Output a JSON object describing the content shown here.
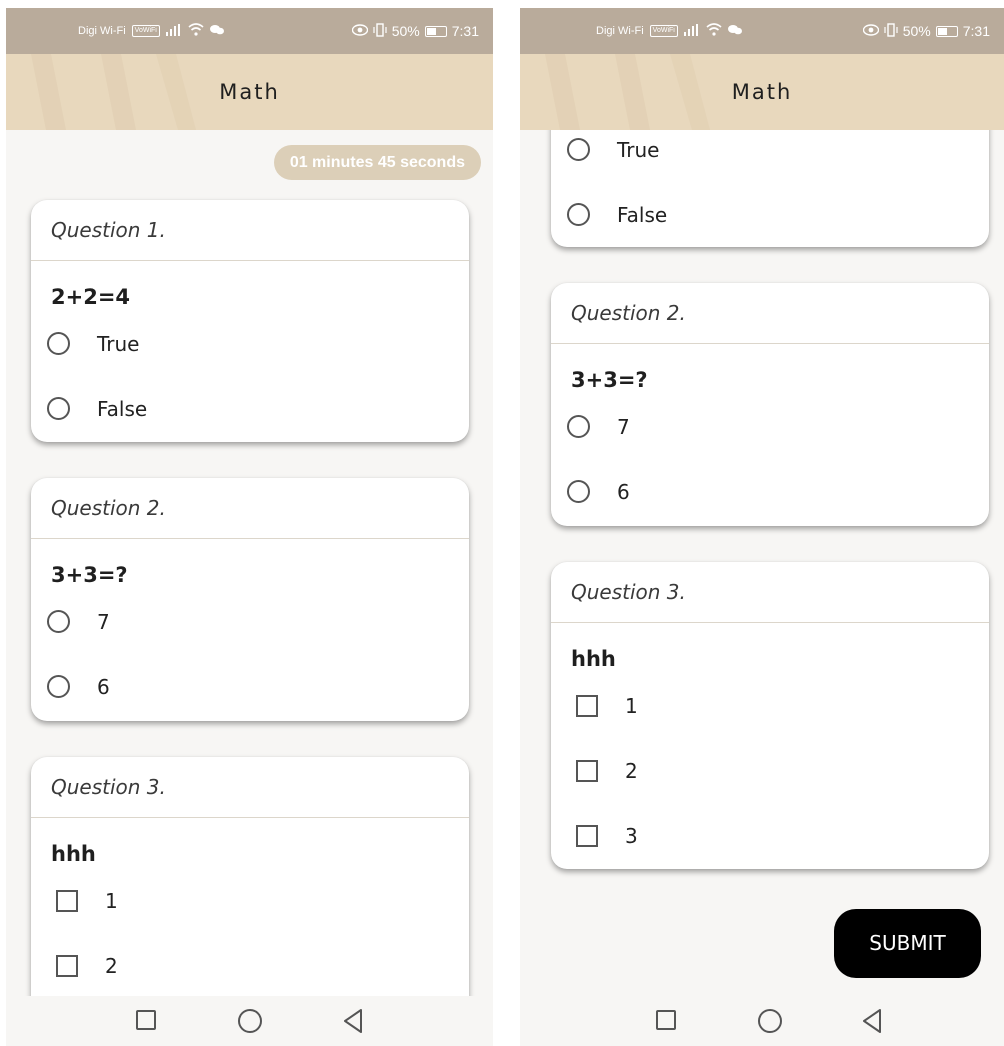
{
  "status_bar": {
    "carrier": "Digi Wi-Fi",
    "volte_badge": "VoWiFi",
    "battery": "50%",
    "time": "7:31"
  },
  "app": {
    "title": "Math"
  },
  "timer": {
    "text": "01 minutes 45 seconds"
  },
  "questions": [
    {
      "header": "Question 1.",
      "text": "2+2=4",
      "type": "radio",
      "options": [
        "True",
        "False"
      ]
    },
    {
      "header": "Question 2.",
      "text": "3+3=?",
      "type": "radio",
      "options": [
        "7",
        "6"
      ]
    },
    {
      "header": "Question 3.",
      "text": "hhh",
      "type": "checkbox",
      "options": [
        "1",
        "2",
        "3"
      ]
    }
  ],
  "submit": {
    "label": "SUBMIT"
  },
  "colors": {
    "appbar": "#e8d8bd",
    "statusbar": "#b9ab9b",
    "timer_bg": "#dccfb8",
    "submit_bg": "#000000"
  },
  "icons": [
    "wifi-icon",
    "signal-icon",
    "eye-icon",
    "vibrate-icon",
    "battery-icon",
    "nav-recent-icon",
    "nav-home-icon",
    "nav-back-icon"
  ]
}
